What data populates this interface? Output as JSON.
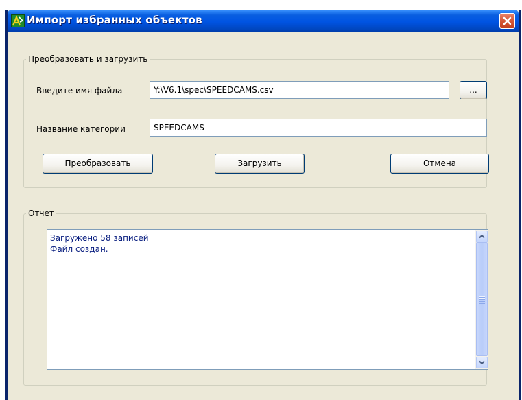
{
  "window": {
    "title": "Импорт избранных объектов",
    "icon": "app-logo-icon",
    "close_icon": "close-icon"
  },
  "convert_group": {
    "legend": "Преобразовать и загрузить",
    "file_label": "Введите имя файла",
    "file_value": "Y:\\V6.1\\spec\\SPEEDCAMS.csv",
    "browse_label": "...",
    "category_label": "Название категории",
    "category_value": "SPEEDCAMS",
    "convert_button": "Преобразовать",
    "load_button": "Загрузить",
    "cancel_button": "Отмена"
  },
  "report_group": {
    "legend": "Отчет",
    "lines": [
      "Загружено 58 записей",
      "Файл создан."
    ],
    "text_color": "#0A1F80"
  },
  "colors": {
    "titlebar": "#0054E3",
    "window_bg": "#ECE9D8",
    "close_button": "#D65A3A"
  }
}
